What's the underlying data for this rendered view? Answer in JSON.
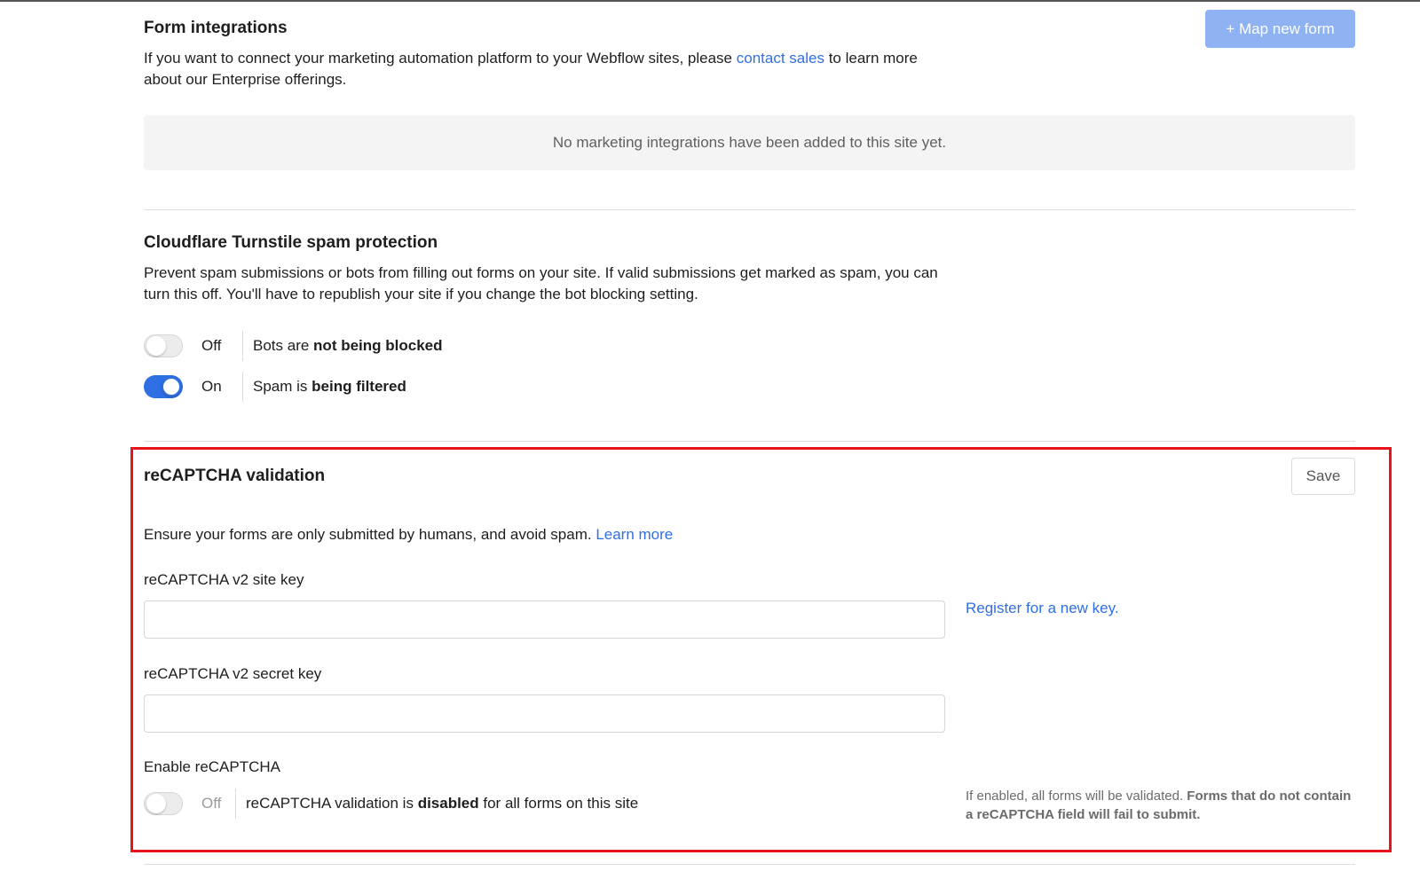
{
  "form_integrations": {
    "title": "Form integrations",
    "desc_before": "If you want to connect your marketing automation platform to your Webflow sites, please ",
    "desc_link": "contact sales",
    "desc_after": " to learn more about our Enterprise offerings.",
    "map_button": "+ Map new form",
    "empty_message": "No marketing integrations have been added to this site yet."
  },
  "turnstile": {
    "title": "Cloudflare Turnstile spam protection",
    "desc": "Prevent spam submissions or bots from filling out forms on your site. If valid submissions get marked as spam, you can turn this off. You'll have to republish your site if you change the bot blocking setting.",
    "bots_toggle": {
      "state": "Off",
      "text_prefix": "Bots are ",
      "text_bold": "not being blocked",
      "enabled": false
    },
    "spam_toggle": {
      "state": "On",
      "text_prefix": "Spam is ",
      "text_bold": "being filtered",
      "enabled": true
    }
  },
  "recaptcha": {
    "title": "reCAPTCHA validation",
    "save_button": "Save",
    "desc": "Ensure your forms are only submitted by humans, and avoid spam. ",
    "learn_more": "Learn more",
    "site_key_label": "reCAPTCHA v2 site key",
    "site_key_value": "",
    "register_link": "Register for a new key.",
    "secret_key_label": "reCAPTCHA v2 secret key",
    "secret_key_value": "",
    "enable_label": "Enable reCAPTCHA",
    "enable_toggle": {
      "state": "Off",
      "text_prefix": "reCAPTCHA validation is ",
      "text_bold": "disabled",
      "text_suffix": " for all forms on this site",
      "enabled": false
    },
    "hint_normal": "If enabled, all forms will be validated. ",
    "hint_bold": "Forms that do not contain a reCAPTCHA field will fail to submit."
  },
  "colors": {
    "accent": "#2f6fe4",
    "map_button_bg": "#8fb2f3",
    "highlight_border": "#e8141b"
  }
}
